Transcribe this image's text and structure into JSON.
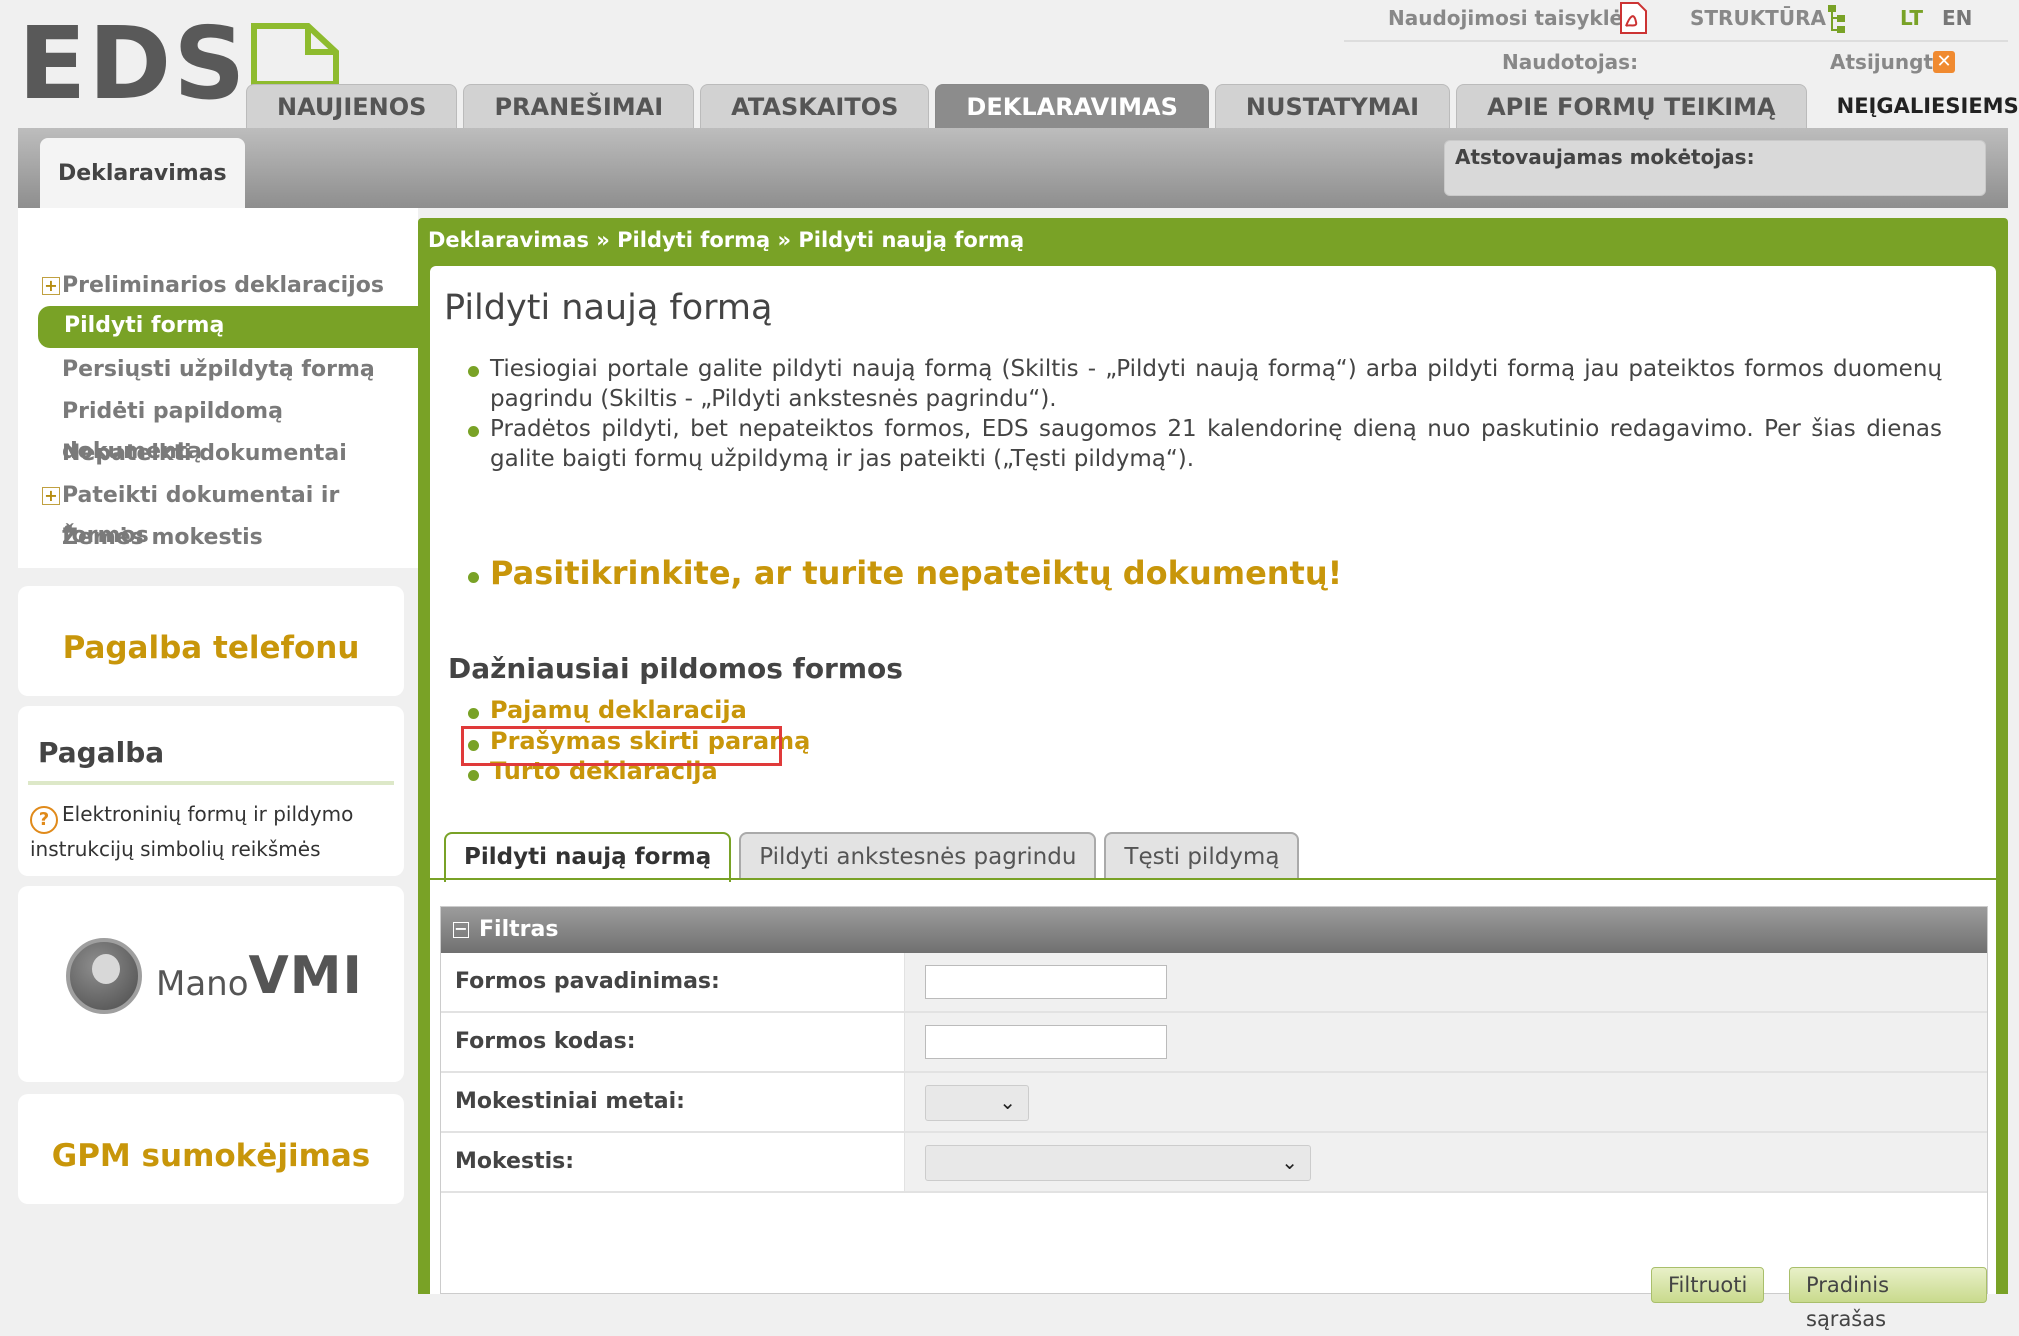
{
  "header": {
    "logo_text": "EDS",
    "rules_link": "Naudojimosi taisyklės",
    "structure_link": "STRUKTŪRA",
    "lang_lt": "LT",
    "lang_en": "EN",
    "user_label": "Naudotojas:",
    "logout": "Atsijungti"
  },
  "nav": {
    "tabs": [
      "NAUJIENOS",
      "PRANEŠIMAI",
      "ATASKAITOS",
      "DEKLARAVIMAS",
      "NUSTATYMAI",
      "APIE FORMŲ TEIKIMĄ"
    ],
    "accessibility": "NEĮGALIESIEMS",
    "active": "DEKLARAVIMAS"
  },
  "band": {
    "subtab": "Deklaravimas",
    "payer_label": "Atstovaujamas mokėtojas:"
  },
  "sidebar": {
    "items": [
      {
        "label": "Preliminarios deklaracijos",
        "expandable": true
      },
      {
        "label": "Pildyti formą",
        "active": true
      },
      {
        "label": "Persiųsti užpildytą formą"
      },
      {
        "label": "Pridėti papildomą dokumentą"
      },
      {
        "label": "Nepateikti dokumentai"
      },
      {
        "label": "Pateikti dokumentai ir formos",
        "expandable": true
      },
      {
        "label": "Žemės mokestis"
      }
    ],
    "phone_help": "Pagalba telefonu",
    "help_title": "Pagalba",
    "help_text": "Elektroninių formų ir pildymo instrukcijų simbolių reikšmės",
    "mano_small": "Mano",
    "mano_big": "VMI",
    "gpm": "GPM sumokėjimas"
  },
  "main": {
    "breadcrumb": "Deklaravimas » Pildyti formą » Pildyti naują formą",
    "title": "Pildyti naują formą",
    "bullets": [
      "Tiesiogiai portale galite pildyti naują formą (Skiltis - „Pildyti naują formą“) arba pildyti formą jau pateiktos formos duomenų pagrindu (Skiltis - „Pildyti ankstesnės pagrindu“).",
      "Pradėtos pildyti, bet nepateiktos formos, EDS saugomos 21 kalendorinę dieną nuo paskutinio redagavimo. Per šias dienas galite baigti formų užpildymą ir jas pateikti („Tęsti pildymą“)."
    ],
    "warning": "Pasitikrinkite, ar turite nepateiktų dokumentų!",
    "frequent_title": "Dažniausiai pildomos formos",
    "frequent_forms": [
      "Pajamų deklaracija",
      "Prašymas skirti paramą",
      "Turto deklaracija"
    ],
    "highlighted_form": "Prašymas skirti paramą",
    "tabs": [
      "Pildyti naują formą",
      "Pildyti ankstesnės pagrindu",
      "Tęsti pildymą"
    ],
    "filter": {
      "title": "Filtras",
      "form_name_label": "Formos pavadinimas:",
      "form_name_value": "",
      "form_code_label": "Formos kodas:",
      "form_code_value": "",
      "tax_year_label": "Mokestiniai metai:",
      "tax_year_value": "",
      "tax_label": "Mokestis:",
      "tax_value": "",
      "filter_button": "Filtruoti",
      "reset_button": "Pradinis sąrašas"
    }
  },
  "colors": {
    "accent_green": "#79a226",
    "gold": "#c8960a",
    "highlight_red": "#e03a3a"
  }
}
